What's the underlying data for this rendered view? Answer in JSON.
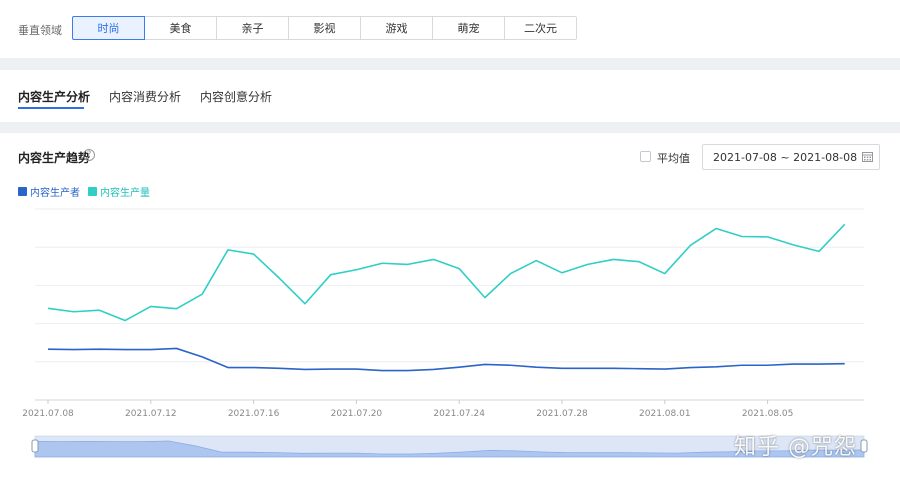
{
  "filter": {
    "label": "垂直领域",
    "options": [
      "时尚",
      "美食",
      "亲子",
      "影视",
      "游戏",
      "萌宠",
      "二次元"
    ],
    "selected": "时尚"
  },
  "tabs": [
    "内容生产分析",
    "内容消费分析",
    "内容创意分析"
  ],
  "active_tab": "内容生产分析",
  "chart_header": {
    "title": "内容生产趋势",
    "average_label": "平均值",
    "date_range": "2021-07-08 ~ 2021-08-08"
  },
  "colors": {
    "accent": "#2f6fe6",
    "producer": "#2a64c8",
    "output": "#2fcfc6"
  },
  "watermark": "知乎 @咒怨",
  "chart_data": {
    "type": "line",
    "x_tick_labels": [
      "2021.07.08",
      "2021.07.12",
      "2021.07.16",
      "2021.07.20",
      "2021.07.24",
      "2021.07.28",
      "2021.08.01",
      "2021.08.05"
    ],
    "x": [
      "2021.07.08",
      "2021.07.09",
      "2021.07.10",
      "2021.07.11",
      "2021.07.12",
      "2021.07.13",
      "2021.07.14",
      "2021.07.15",
      "2021.07.16",
      "2021.07.17",
      "2021.07.18",
      "2021.07.19",
      "2021.07.20",
      "2021.07.21",
      "2021.07.22",
      "2021.07.23",
      "2021.07.24",
      "2021.07.25",
      "2021.07.26",
      "2021.07.27",
      "2021.07.28",
      "2021.07.29",
      "2021.07.30",
      "2021.07.31",
      "2021.08.01",
      "2021.08.02",
      "2021.08.03",
      "2021.08.04",
      "2021.08.05",
      "2021.08.06",
      "2021.08.07",
      "2021.08.08"
    ],
    "series": [
      {
        "name": "内容生产者",
        "values": [
          26.6,
          26.4,
          26.6,
          26.4,
          26.4,
          27.0,
          22.6,
          17.0,
          17.0,
          16.6,
          16.0,
          16.2,
          16.2,
          15.4,
          15.4,
          16.0,
          17.2,
          18.6,
          18.2,
          17.2,
          16.6,
          16.6,
          16.6,
          16.4,
          16.2,
          17.0,
          17.4,
          18.2,
          18.2,
          18.8,
          18.8,
          19.0
        ]
      },
      {
        "name": "内容生产量",
        "values": [
          48.0,
          46.2,
          47.0,
          41.6,
          49.0,
          47.8,
          55.4,
          78.6,
          76.4,
          63.8,
          50.4,
          65.6,
          68.2,
          71.6,
          71.0,
          73.6,
          68.8,
          53.6,
          66.2,
          73.0,
          66.6,
          71.0,
          73.6,
          72.4,
          66.2,
          81.0,
          89.8,
          85.6,
          85.4,
          81.2,
          77.8,
          92.0
        ]
      }
    ],
    "ylim": [
      0,
      100
    ],
    "grid": true,
    "legend_position": "top-left"
  }
}
